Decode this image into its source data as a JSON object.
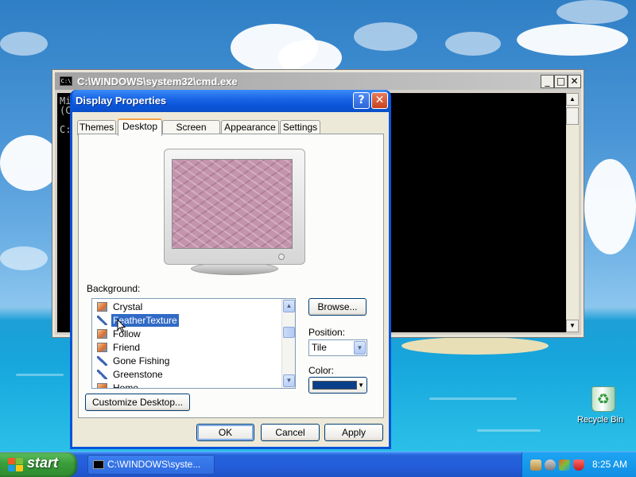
{
  "cmd_window": {
    "title": "C:\\WINDOWS\\system32\\cmd.exe",
    "icon": "cmd-icon",
    "console_lines": [
      "Mi",
      "(C",
      "",
      "C:"
    ],
    "minimize": "_",
    "maximize": "□",
    "close": "✕"
  },
  "dialog": {
    "title": "Display Properties",
    "help": "?",
    "close": "✕",
    "tabs": [
      "Themes",
      "Desktop",
      "Screen Saver",
      "Appearance",
      "Settings"
    ],
    "active_tab": "Desktop",
    "background_label": "Background:",
    "background_items": [
      {
        "label": "Crystal",
        "icon": "image-icon"
      },
      {
        "label": "FeatherTexture",
        "icon": "brush-icon",
        "selected": true
      },
      {
        "label": "Follow",
        "icon": "image-icon"
      },
      {
        "label": "Friend",
        "icon": "image-icon"
      },
      {
        "label": "Gone Fishing",
        "icon": "brush-icon"
      },
      {
        "label": "Greenstone",
        "icon": "brush-icon"
      },
      {
        "label": "Home",
        "icon": "image-icon"
      }
    ],
    "browse": "Browse...",
    "position_label": "Position:",
    "position_value": "Tile",
    "color_label": "Color:",
    "color_value": "#0a3f8a",
    "customize": "Customize Desktop...",
    "ok": "OK",
    "cancel": "Cancel",
    "apply": "Apply"
  },
  "desktop": {
    "recycle_bin": "Recycle Bin"
  },
  "taskbar": {
    "start": "start",
    "tasks": [
      "C:\\WINDOWS\\syste..."
    ],
    "clock": "8:25 AM"
  }
}
